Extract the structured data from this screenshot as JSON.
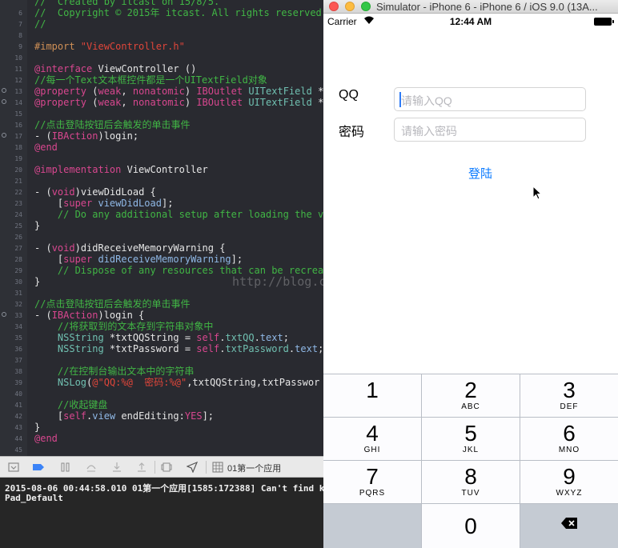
{
  "editor": {
    "lines": [
      {
        "n": "",
        "bp": false,
        "parts": [
          [
            "c-cmt",
            "//  Created by itcast on 15/8/5."
          ]
        ]
      },
      {
        "n": "6",
        "bp": false,
        "parts": [
          [
            "c-cmt",
            "//  Copyright © 2015年 itcast. All rights reserved."
          ]
        ]
      },
      {
        "n": "7",
        "bp": false,
        "parts": [
          [
            "c-cmt",
            "//"
          ]
        ]
      },
      {
        "n": "8",
        "bp": false,
        "parts": []
      },
      {
        "n": "9",
        "bp": false,
        "parts": [
          [
            "c-dir",
            "#import "
          ],
          [
            "c-str",
            "\"ViewController.h\""
          ]
        ]
      },
      {
        "n": "10",
        "bp": false,
        "parts": []
      },
      {
        "n": "11",
        "bp": false,
        "parts": [
          [
            "c-key",
            "@interface"
          ],
          [
            "c-plain",
            " ViewController ()"
          ]
        ]
      },
      {
        "n": "12",
        "bp": false,
        "parts": [
          [
            "c-cmt",
            "//每一个Text文本框控件都是一个UITextField对象"
          ]
        ]
      },
      {
        "n": "13",
        "bp": true,
        "parts": [
          [
            "c-key",
            "@property"
          ],
          [
            "c-plain",
            " ("
          ],
          [
            "c-key",
            "weak"
          ],
          [
            "c-plain",
            ", "
          ],
          [
            "c-key",
            "nonatomic"
          ],
          [
            "c-plain",
            ") "
          ],
          [
            "c-key",
            "IBOutlet"
          ],
          [
            "c-plain",
            " "
          ],
          [
            "c-cls",
            "UITextField"
          ],
          [
            "c-plain",
            " *"
          ]
        ]
      },
      {
        "n": "14",
        "bp": true,
        "parts": [
          [
            "c-key",
            "@property"
          ],
          [
            "c-plain",
            " ("
          ],
          [
            "c-key",
            "weak"
          ],
          [
            "c-plain",
            ", "
          ],
          [
            "c-key",
            "nonatomic"
          ],
          [
            "c-plain",
            ") "
          ],
          [
            "c-key",
            "IBOutlet"
          ],
          [
            "c-plain",
            " "
          ],
          [
            "c-cls",
            "UITextField"
          ],
          [
            "c-plain",
            " *"
          ]
        ]
      },
      {
        "n": "15",
        "bp": false,
        "parts": []
      },
      {
        "n": "16",
        "bp": false,
        "parts": [
          [
            "c-cmt",
            "//点击登陆按钮后会触发的单击事件"
          ]
        ]
      },
      {
        "n": "17",
        "bp": true,
        "parts": [
          [
            "c-plain",
            "- ("
          ],
          [
            "c-key",
            "IBAction"
          ],
          [
            "c-plain",
            ")login;"
          ]
        ]
      },
      {
        "n": "18",
        "bp": false,
        "parts": [
          [
            "c-key",
            "@end"
          ]
        ]
      },
      {
        "n": "19",
        "bp": false,
        "parts": []
      },
      {
        "n": "20",
        "bp": false,
        "parts": [
          [
            "c-key",
            "@implementation"
          ],
          [
            "c-plain",
            " ViewController"
          ]
        ]
      },
      {
        "n": "21",
        "bp": false,
        "parts": []
      },
      {
        "n": "22",
        "bp": false,
        "parts": [
          [
            "c-plain",
            "- ("
          ],
          [
            "c-key",
            "void"
          ],
          [
            "c-plain",
            ")viewDidLoad {"
          ]
        ]
      },
      {
        "n": "23",
        "bp": false,
        "parts": [
          [
            "c-plain",
            "    ["
          ],
          [
            "c-key",
            "super"
          ],
          [
            "c-plain",
            " "
          ],
          [
            "c-mth",
            "viewDidLoad"
          ],
          [
            "c-plain",
            "];"
          ]
        ]
      },
      {
        "n": "24",
        "bp": false,
        "parts": [
          [
            "c-cmt",
            "    // Do any additional setup after loading the v"
          ]
        ]
      },
      {
        "n": "25",
        "bp": false,
        "parts": [
          [
            "c-plain",
            "}"
          ]
        ]
      },
      {
        "n": "26",
        "bp": false,
        "parts": []
      },
      {
        "n": "27",
        "bp": false,
        "parts": [
          [
            "c-plain",
            "- ("
          ],
          [
            "c-key",
            "void"
          ],
          [
            "c-plain",
            ")didReceiveMemoryWarning {"
          ]
        ]
      },
      {
        "n": "28",
        "bp": false,
        "parts": [
          [
            "c-plain",
            "    ["
          ],
          [
            "c-key",
            "super"
          ],
          [
            "c-plain",
            " "
          ],
          [
            "c-mth",
            "didReceiveMemoryWarning"
          ],
          [
            "c-plain",
            "];"
          ]
        ]
      },
      {
        "n": "29",
        "bp": false,
        "parts": [
          [
            "c-cmt",
            "    // Dispose of any resources that can be recrea"
          ]
        ]
      },
      {
        "n": "30",
        "bp": false,
        "parts": [
          [
            "c-plain",
            "}"
          ]
        ]
      },
      {
        "n": "31",
        "bp": false,
        "parts": []
      },
      {
        "n": "32",
        "bp": false,
        "parts": [
          [
            "c-cmt",
            "//点击登陆按钮后会触发的单击事件"
          ]
        ]
      },
      {
        "n": "33",
        "bp": true,
        "parts": [
          [
            "c-plain",
            "- ("
          ],
          [
            "c-key",
            "IBAction"
          ],
          [
            "c-plain",
            ")login {"
          ]
        ]
      },
      {
        "n": "34",
        "bp": false,
        "parts": [
          [
            "c-cmt",
            "    //将获取到的文本存到字符串对象中"
          ]
        ]
      },
      {
        "n": "35",
        "bp": false,
        "parts": [
          [
            "c-plain",
            "    "
          ],
          [
            "c-cls",
            "NSString"
          ],
          [
            "c-plain",
            " *txtQQString = "
          ],
          [
            "c-key",
            "self"
          ],
          [
            "c-plain",
            "."
          ],
          [
            "c-cls",
            "txtQQ"
          ],
          [
            "c-plain",
            "."
          ],
          [
            "c-mth",
            "text"
          ],
          [
            "c-plain",
            ";"
          ]
        ]
      },
      {
        "n": "36",
        "bp": false,
        "parts": [
          [
            "c-plain",
            "    "
          ],
          [
            "c-cls",
            "NSString"
          ],
          [
            "c-plain",
            " *txtPassword = "
          ],
          [
            "c-key",
            "self"
          ],
          [
            "c-plain",
            "."
          ],
          [
            "c-cls",
            "txtPassword"
          ],
          [
            "c-plain",
            "."
          ],
          [
            "c-mth",
            "text"
          ],
          [
            "c-plain",
            ";"
          ]
        ]
      },
      {
        "n": "37",
        "bp": false,
        "parts": []
      },
      {
        "n": "38",
        "bp": false,
        "parts": [
          [
            "c-cmt",
            "    //在控制台输出文本中的字符串"
          ]
        ]
      },
      {
        "n": "39",
        "bp": false,
        "parts": [
          [
            "c-plain",
            "    "
          ],
          [
            "c-cls",
            "NSLog"
          ],
          [
            "c-plain",
            "("
          ],
          [
            "c-str",
            "@\"QQ:%@  密码:%@\""
          ],
          [
            "c-plain",
            ",txtQQString,txtPasswor"
          ]
        ]
      },
      {
        "n": "40",
        "bp": false,
        "parts": []
      },
      {
        "n": "41",
        "bp": false,
        "parts": [
          [
            "c-cmt",
            "    //收起键盘"
          ]
        ]
      },
      {
        "n": "42",
        "bp": false,
        "parts": [
          [
            "c-plain",
            "    ["
          ],
          [
            "c-key",
            "self"
          ],
          [
            "c-plain",
            "."
          ],
          [
            "c-mth",
            "view"
          ],
          [
            "c-plain",
            " endEditing:"
          ],
          [
            "c-key",
            "YES"
          ],
          [
            "c-plain",
            "];"
          ]
        ]
      },
      {
        "n": "43",
        "bp": false,
        "parts": [
          [
            "c-plain",
            "}"
          ]
        ]
      },
      {
        "n": "44",
        "bp": false,
        "parts": [
          [
            "c-key",
            "@end"
          ]
        ]
      },
      {
        "n": "45",
        "bp": false,
        "parts": []
      }
    ],
    "watermark": "http://blog.csdn.net/"
  },
  "debug_bar": {
    "app_name": "01第一个应用"
  },
  "console": {
    "lines": [
      "2015-08-06 00:44:58.010 01第一个应用[1585:172388] Can't find k",
      "Pad_Default"
    ]
  },
  "simulator": {
    "window_title": "Simulator - iPhone 6 - iPhone 6 / iOS 9.0 (13A...",
    "status": {
      "carrier": "Carrier",
      "time": "12:44 AM"
    },
    "qq_label": "QQ",
    "qq_placeholder": "请输入QQ",
    "password_label": "密码",
    "password_placeholder": "请输入密码",
    "login_button": "登陆"
  },
  "keypad": {
    "keys": [
      {
        "num": "1",
        "letters": ""
      },
      {
        "num": "2",
        "letters": "ABC"
      },
      {
        "num": "3",
        "letters": "DEF"
      },
      {
        "num": "4",
        "letters": "GHI"
      },
      {
        "num": "5",
        "letters": "JKL"
      },
      {
        "num": "6",
        "letters": "MNO"
      },
      {
        "num": "7",
        "letters": "PQRS"
      },
      {
        "num": "8",
        "letters": "TUV"
      },
      {
        "num": "9",
        "letters": "WXYZ"
      },
      {
        "num": "",
        "letters": ""
      },
      {
        "num": "0",
        "letters": ""
      },
      {
        "num": "",
        "letters": "",
        "icon": "delete-backspace-icon"
      }
    ]
  }
}
